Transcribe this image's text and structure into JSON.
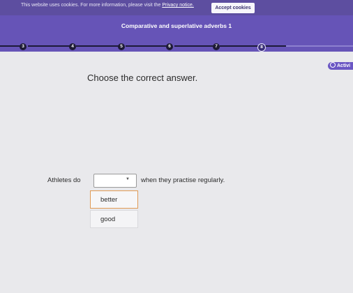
{
  "cookie_bar": {
    "text": "This website uses cookies. For more information, please visit the",
    "link": "Privacy notice.",
    "accept_label": "Accept cookies"
  },
  "lesson": {
    "title": "Comparative and superlative adverbs 1",
    "steps": [
      "3",
      "4",
      "5",
      "6",
      "7",
      "8"
    ],
    "current_step": "8",
    "activity_label": "Activi"
  },
  "question": {
    "instruction": "Choose the correct answer.",
    "sentence_before": "Athletes do",
    "sentence_after": "when they practise regularly.",
    "dropdown_value": "",
    "options": [
      "better",
      "good"
    ]
  }
}
